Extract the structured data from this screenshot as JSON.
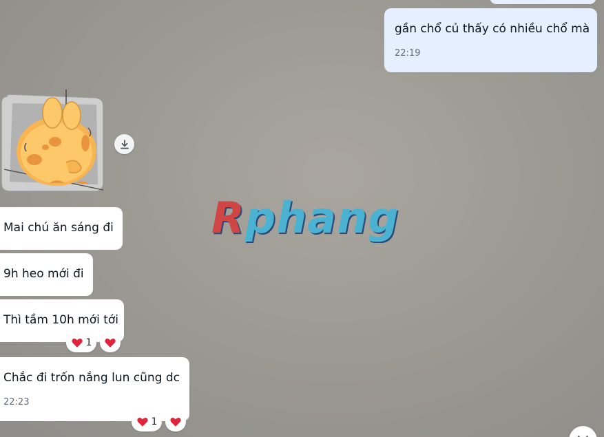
{
  "messages": [
    {
      "direction": "outgoing",
      "text": "gần chổ củ thấy có nhiều chổ mà",
      "time": "22:19"
    },
    {
      "direction": "incoming",
      "type": "sticker",
      "description_icon": "sticker-image"
    },
    {
      "direction": "incoming",
      "text": "Mai chú ăn sáng đi"
    },
    {
      "direction": "incoming",
      "text": "9h heo mới đi"
    },
    {
      "direction": "incoming",
      "text": "Thì tầm 10h mới tới",
      "reaction": {
        "emoji": "heart",
        "count": "1"
      }
    },
    {
      "direction": "incoming",
      "text": "Chắc đi trốn nắng lun cũng dc",
      "time": "22:23",
      "reaction": {
        "emoji": "heart",
        "count": "1"
      }
    }
  ],
  "watermark": {
    "first": "R",
    "rest": "phang"
  },
  "colors": {
    "outgoing_bubble": "#e6efff",
    "incoming_bubble": "#ffffff",
    "heart": "#e0243a",
    "watermark_red": "#d63a3a",
    "watermark_blue": "#3fb6d9"
  }
}
